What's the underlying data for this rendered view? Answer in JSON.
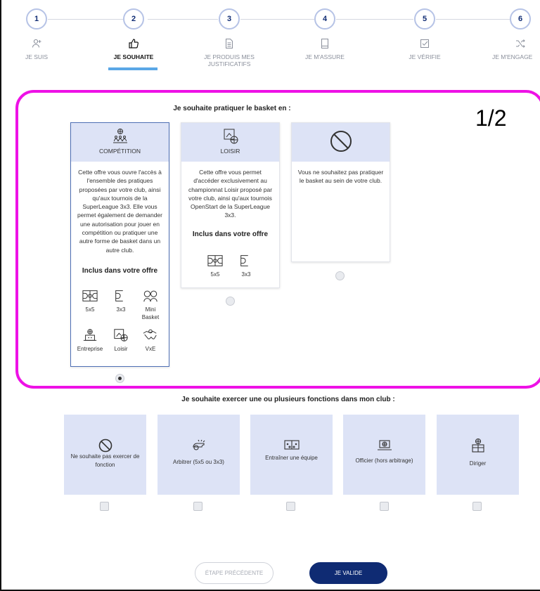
{
  "stepper": {
    "steps": [
      {
        "number": "1",
        "label": "JE SUIS",
        "icon": "user-plus-icon"
      },
      {
        "number": "2",
        "label": "JE SOUHAITE",
        "icon": "thumbs-up-icon"
      },
      {
        "number": "3",
        "label": "JE PRODUIS MES JUSTIFICATIFS",
        "label_line1": "JE PRODUIS MES",
        "label_line2": "JUSTIFICATIFS",
        "icon": "document-icon"
      },
      {
        "number": "4",
        "label": "JE M'ASSURE",
        "icon": "book-icon"
      },
      {
        "number": "5",
        "label": "JE VÉRIFIE",
        "icon": "checkbox-icon"
      },
      {
        "number": "6",
        "label": "JE M'ENGAGE",
        "icon": "shuffle-icon"
      }
    ],
    "active_step": 2
  },
  "annotation": {
    "text": "1/2",
    "color": "#ee11e6"
  },
  "practice": {
    "title": "Je souhaite pratiquer le basket en :",
    "cards": [
      {
        "label": "COMPÉTITION",
        "icon": "basketball-team-icon",
        "description_lines": [
          "Cette offre vous ouvre l'accès à",
          "l'ensemble des pratiques",
          "proposées par votre club, ainsi",
          "qu'aux tournois de la",
          "SuperLeague 3x3. Elle vous",
          "permet également de demander",
          "une autorisation pour jouer en",
          "compétition ou pratiquer une",
          "autre forme de basket dans un",
          "autre club."
        ],
        "included_title": "Inclus dans votre offre",
        "included": [
          {
            "label": "5x5",
            "icon": "full-court-icon"
          },
          {
            "label": "3x3",
            "icon": "half-court-icon"
          },
          {
            "label": "Mini Basket",
            "line1": "Mini",
            "line2": "Basket",
            "icon": "kids-icon"
          },
          {
            "label": "Entreprise",
            "icon": "company-icon"
          },
          {
            "label": "Loisir",
            "icon": "leisure-icon"
          },
          {
            "label": "VxE",
            "icon": "handshake-icon"
          }
        ],
        "selected": true
      },
      {
        "label": "LOISIR",
        "icon": "leisure-court-icon",
        "description_lines": [
          "Cette offre vous permet",
          "d'accéder exclusivement au",
          "championnat Loisir proposé par",
          "votre club, ainsi qu'aux tournois",
          "OpenStart de la SuperLeague",
          "3x3."
        ],
        "included_title": "Inclus dans votre offre",
        "included": [
          {
            "label": "5x5",
            "icon": "full-court-icon"
          },
          {
            "label": "3x3",
            "icon": "half-court-icon"
          }
        ],
        "selected": false
      },
      {
        "label": "",
        "icon": "prohibited-icon",
        "description_lines": [
          "Vous ne souhaitez pas pratiquer",
          "le basket au sein de votre club."
        ],
        "selected": false
      }
    ]
  },
  "functions": {
    "title": "Je souhaite exercer une ou plusieurs fonctions dans mon club :",
    "items": [
      {
        "label_line1": "Ne souhaite pas exercer de",
        "label_line2": "fonction",
        "icon": "prohibited-icon"
      },
      {
        "label_line1": "Arbitrer (5x5 ou 3x3)",
        "label_line2": "",
        "icon": "whistle-icon"
      },
      {
        "label_line1": "Entraîner une équipe",
        "label_line2": "",
        "icon": "tactics-board-icon"
      },
      {
        "label_line1": "Officier (hors arbitrage)",
        "label_line2": "",
        "icon": "laptop-icon"
      },
      {
        "label_line1": "Diriger",
        "label_line2": "",
        "icon": "club-manager-icon"
      }
    ]
  },
  "buttons": {
    "previous": "ÉTAPE PRÉCÉDENTE",
    "validate": "JE VALIDE"
  },
  "colors": {
    "primary": "#0f2b73",
    "card_header": "#dde3f6",
    "active_underline": "#5aa7e6"
  }
}
